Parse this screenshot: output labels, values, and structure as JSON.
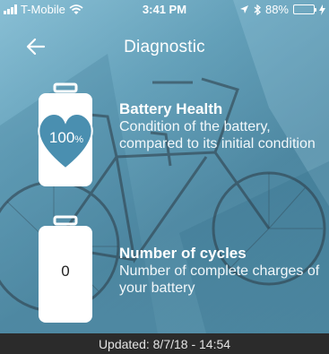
{
  "status_bar": {
    "carrier": "T-Mobile",
    "time": "3:41 PM",
    "battery_percent": "88%",
    "battery_level": 0.88,
    "icons": [
      "signal-icon",
      "wifi-icon",
      "location-icon",
      "bluetooth-icon",
      "battery-icon",
      "charging-icon"
    ]
  },
  "nav": {
    "title": "Diagnostic",
    "back_icon": "back-arrow-icon"
  },
  "battery_health": {
    "value": "100",
    "unit": "%",
    "title": "Battery Health",
    "description": "Condition of the battery, compared to its initial condition",
    "icon": "battery-heart-icon"
  },
  "cycles": {
    "value": "0",
    "title": "Number of cycles",
    "description": "Number of complete charges of your battery",
    "icon": "battery-cycles-icon"
  },
  "footer": {
    "updated": "Updated: 8/7/18 - 14:54"
  },
  "colors": {
    "background": "#5b9cb6",
    "footer": "#2b2b2b",
    "heart": "#4a8fb0",
    "battery_fill": "#4cd964"
  }
}
